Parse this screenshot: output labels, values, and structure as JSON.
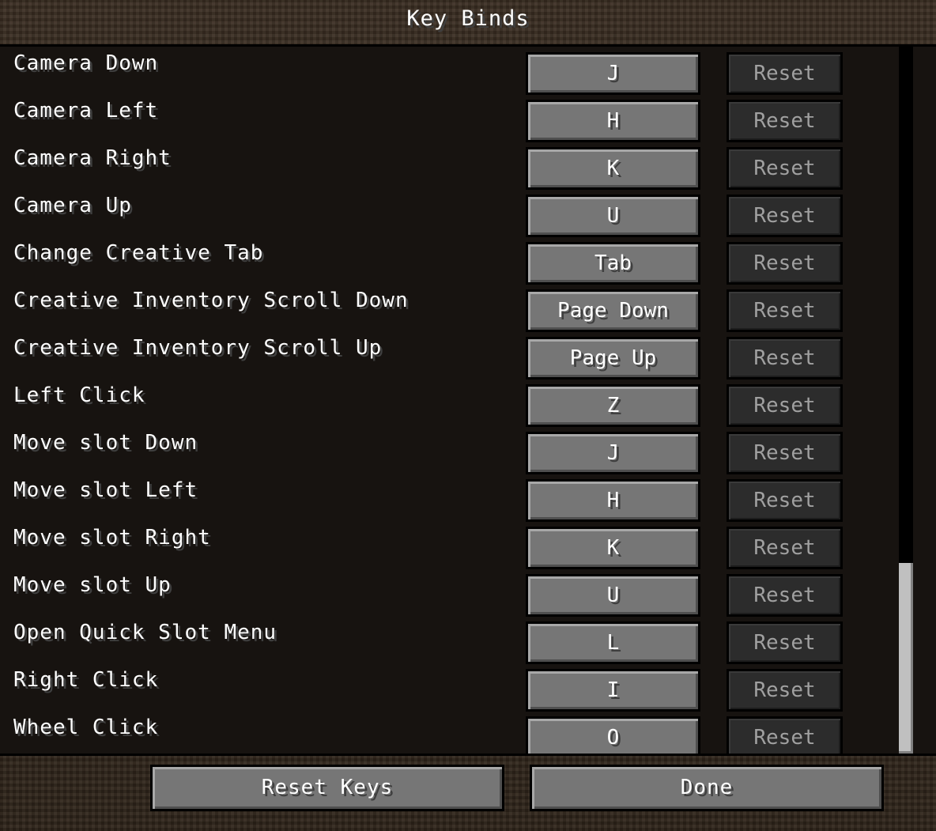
{
  "title": "Key Binds",
  "bindings": [
    {
      "action": "Camera Down",
      "key": "J",
      "reset": "Reset"
    },
    {
      "action": "Camera Left",
      "key": "H",
      "reset": "Reset"
    },
    {
      "action": "Camera Right",
      "key": "K",
      "reset": "Reset"
    },
    {
      "action": "Camera Up",
      "key": "U",
      "reset": "Reset"
    },
    {
      "action": "Change Creative Tab",
      "key": "Tab",
      "reset": "Reset"
    },
    {
      "action": "Creative Inventory Scroll Down",
      "key": "Page Down",
      "reset": "Reset"
    },
    {
      "action": "Creative Inventory Scroll Up",
      "key": "Page Up",
      "reset": "Reset"
    },
    {
      "action": "Left Click",
      "key": "Z",
      "reset": "Reset"
    },
    {
      "action": "Move slot Down",
      "key": "J",
      "reset": "Reset"
    },
    {
      "action": "Move slot Left",
      "key": "H",
      "reset": "Reset"
    },
    {
      "action": "Move slot Right",
      "key": "K",
      "reset": "Reset"
    },
    {
      "action": "Move slot Up",
      "key": "U",
      "reset": "Reset"
    },
    {
      "action": "Open Quick Slot Menu",
      "key": "L",
      "reset": "Reset"
    },
    {
      "action": "Right Click",
      "key": "I",
      "reset": "Reset"
    },
    {
      "action": "Wheel Click",
      "key": "O",
      "reset": "Reset"
    }
  ],
  "scroll": {
    "position_fraction": 1.0,
    "visible_fraction": 0.27
  },
  "footer": {
    "reset_keys_label": "Reset Keys",
    "done_label": "Done"
  }
}
